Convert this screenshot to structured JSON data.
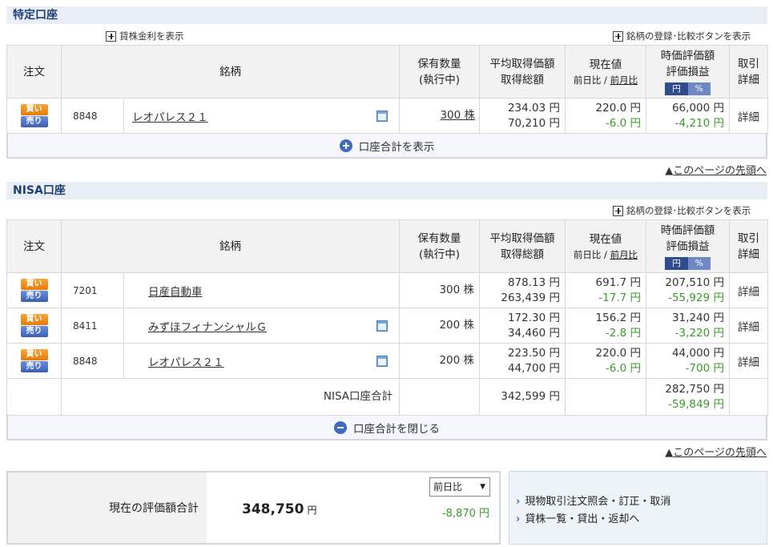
{
  "tokutei": {
    "title": "特定口座",
    "lending_toggle": "貸株金利を表示",
    "register_toggle": "銘柄の登録･比較ボタンを表示",
    "rows": [
      {
        "buy": "買い",
        "sell": "売り",
        "code": "8848",
        "name": "レオパレス２１",
        "qty": "300 株",
        "avg": "234.03 円",
        "cost": "70,210 円",
        "price": "220.0 円",
        "prev": "-6.0 円",
        "mv": "66,000 円",
        "pl": "-4,210 円",
        "detail": "詳細"
      }
    ],
    "toggle_label": "口座合計を表示"
  },
  "headers": {
    "order": "注文",
    "name": "銘柄",
    "qty1": "保有数量",
    "qty2": "(執行中)",
    "avg1": "平均取得価額",
    "avg2": "取得総額",
    "price1": "現在値",
    "price_prev_day": "前日比",
    "price_sep": " / ",
    "price_prev_month": "前月比",
    "mv1": "時価評価額",
    "mv2": "評価損益",
    "yen_btn": "円",
    "pct_btn": "%",
    "det1": "取引",
    "det2": "詳細"
  },
  "nisa": {
    "title": "NISA口座",
    "register_toggle": "銘柄の登録･比較ボタンを表示",
    "rows": [
      {
        "buy": "買い",
        "sell": "売り",
        "code": "7201",
        "name": "日産自動車",
        "qty": "300 株",
        "avg": "878.13 円",
        "cost": "263,439 円",
        "price": "691.7 円",
        "prev": "-17.7 円",
        "mv": "207,510 円",
        "pl": "-55,929 円",
        "detail": "詳細"
      },
      {
        "buy": "買い",
        "sell": "売り",
        "code": "8411",
        "name": "みずほフィナンシャルＧ",
        "qty": "200 株",
        "avg": "172.30 円",
        "cost": "34,460 円",
        "price": "156.2 円",
        "prev": "-2.8 円",
        "mv": "31,240 円",
        "pl": "-3,220 円",
        "detail": "詳細"
      },
      {
        "buy": "買い",
        "sell": "売り",
        "code": "8848",
        "name": "レオパレス２１",
        "qty": "200 株",
        "avg": "223.50 円",
        "cost": "44,700 円",
        "price": "220.0 円",
        "prev": "-6.0 円",
        "mv": "44,000 円",
        "pl": "-700 円",
        "detail": "詳細"
      }
    ],
    "total_label": "NISA口座合計",
    "total_cost": "342,599 円",
    "total_mv": "282,750 円",
    "total_pl": "-59,849 円",
    "toggle_label": "口座合計を閉じる"
  },
  "page_top_prefix": "▲",
  "page_top": "このページの先頭へ",
  "summary": {
    "label": "現在の評価額合計",
    "value": "348,750",
    "unit": "円",
    "select_value": "前日比",
    "change": "-8,870 円"
  },
  "side_links": [
    "現物取引注文照会・訂正・取消",
    "貸株一覧・貸出・返却へ"
  ],
  "colors": {
    "header_bg": "#e9edf5",
    "header_text": "#1f3f7a",
    "negative": "#3a9b2b",
    "buy": "#e47b06",
    "sell": "#3b5fb6"
  }
}
